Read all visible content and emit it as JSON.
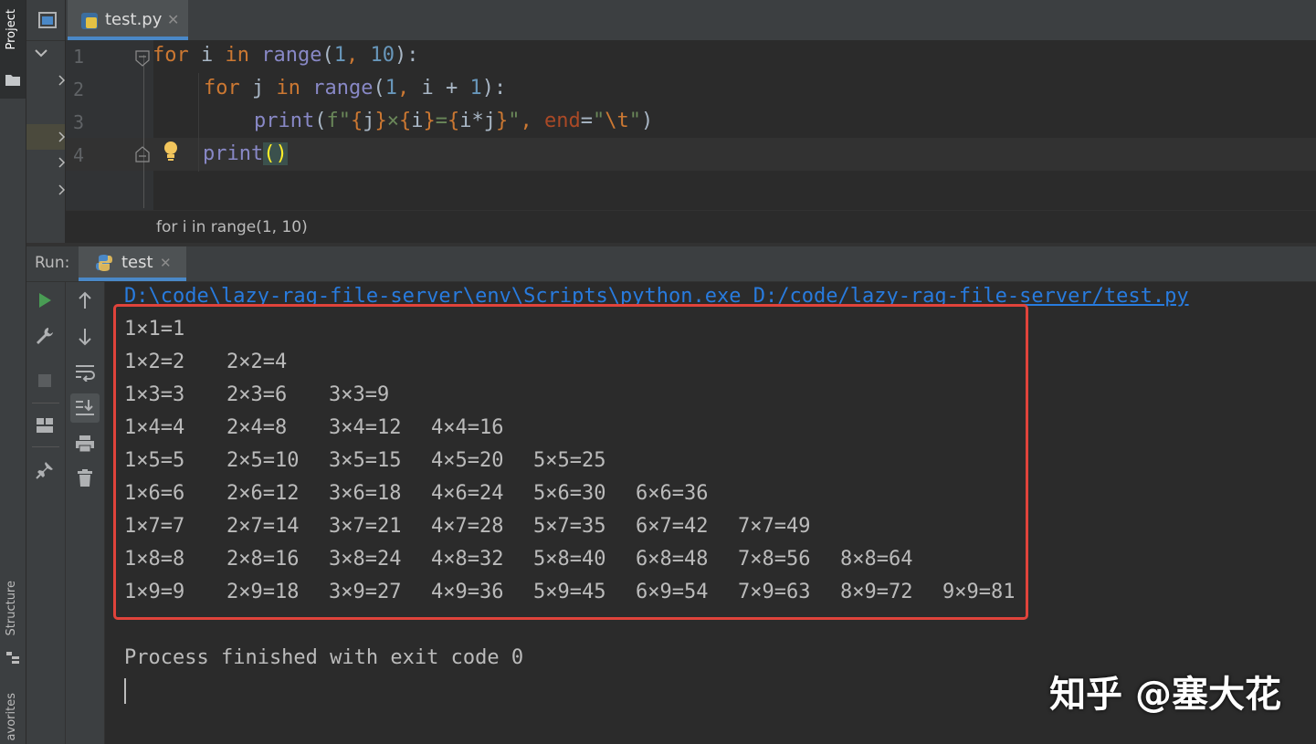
{
  "left_strip": {
    "project_label": "Project",
    "structure_label": "Structure",
    "favorites_label": "avorites"
  },
  "editor": {
    "tab_label": "test.py",
    "line_numbers": [
      "1",
      "2",
      "3",
      "4"
    ],
    "lines": [
      [
        {
          "t": "for",
          "c": "kw"
        },
        {
          "t": " i ",
          "c": ""
        },
        {
          "t": "in",
          "c": "kw"
        },
        {
          "t": " ",
          "c": ""
        },
        {
          "t": "range",
          "c": "bi"
        },
        {
          "t": "(",
          "c": ""
        },
        {
          "t": "1",
          "c": "num"
        },
        {
          "t": ", ",
          "c": "kw"
        },
        {
          "t": "10",
          "c": "num"
        },
        {
          "t": "):",
          "c": ""
        }
      ],
      [
        {
          "t": "for",
          "c": "kw"
        },
        {
          "t": " j ",
          "c": ""
        },
        {
          "t": "in",
          "c": "kw"
        },
        {
          "t": " ",
          "c": ""
        },
        {
          "t": "range",
          "c": "bi"
        },
        {
          "t": "(",
          "c": ""
        },
        {
          "t": "1",
          "c": "num"
        },
        {
          "t": ", ",
          "c": "kw"
        },
        {
          "t": "i + ",
          "c": ""
        },
        {
          "t": "1",
          "c": "num"
        },
        {
          "t": "):",
          "c": ""
        }
      ],
      [
        {
          "t": "print",
          "c": "bi"
        },
        {
          "t": "(",
          "c": ""
        },
        {
          "t": "f\"",
          "c": "str"
        },
        {
          "t": "{",
          "c": "kw"
        },
        {
          "t": "j",
          "c": ""
        },
        {
          "t": "}",
          "c": "kw"
        },
        {
          "t": "×",
          "c": "str"
        },
        {
          "t": "{",
          "c": "kw"
        },
        {
          "t": "i",
          "c": ""
        },
        {
          "t": "}",
          "c": "kw"
        },
        {
          "t": "=",
          "c": "str"
        },
        {
          "t": "{",
          "c": "kw"
        },
        {
          "t": "i*j",
          "c": ""
        },
        {
          "t": "}",
          "c": "kw"
        },
        {
          "t": "\"",
          "c": "str"
        },
        {
          "t": ", ",
          "c": "kw"
        },
        {
          "t": "end",
          "c": "param"
        },
        {
          "t": "=",
          "c": ""
        },
        {
          "t": "\"",
          "c": "str"
        },
        {
          "t": "\\t",
          "c": "esc"
        },
        {
          "t": "\"",
          "c": "str"
        },
        {
          "t": ")",
          "c": ""
        }
      ],
      [
        {
          "t": "print",
          "c": "bi"
        },
        {
          "t": "()",
          "c": "paren-hl"
        }
      ]
    ],
    "breadcrumb": "for i in range(1, 10)"
  },
  "run": {
    "label": "Run:",
    "tab_label": "test",
    "command": "D:\\code\\lazy-rag-file-server\\env\\Scripts\\python.exe D:/code/lazy-rag-file-server/test.py",
    "output": [
      "1×1=1",
      "1×2=2\t2×2=4",
      "1×3=3\t2×3=6\t3×3=9",
      "1×4=4\t2×4=8\t3×4=12\t4×4=16",
      "1×5=5\t2×5=10\t3×5=15\t4×5=20\t5×5=25",
      "1×6=6\t2×6=12\t3×6=18\t4×6=24\t5×6=30\t6×6=36",
      "1×7=7\t2×7=14\t3×7=21\t4×7=28\t5×7=35\t6×7=42\t7×7=49",
      "1×8=8\t2×8=16\t3×8=24\t4×8=32\t5×8=40\t6×8=48\t7×8=56\t8×8=64",
      "1×9=9\t2×9=18\t3×9=27\t4×9=36\t5×9=45\t6×9=54\t7×9=63\t8×9=72\t9×9=81"
    ],
    "finish_message": "Process finished with exit code 0"
  },
  "watermark": "知乎 @塞大花",
  "colors": {
    "keyword": "#cc7832",
    "builtin": "#8888c6",
    "number": "#6897bb",
    "string": "#6a8759",
    "highlight_box": "#e0433b",
    "run_green": "#499c54"
  }
}
